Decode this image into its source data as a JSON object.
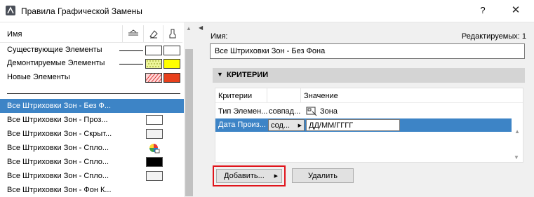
{
  "window": {
    "title": "Правила Графической Замены",
    "help_label": "?",
    "close_label": "✕"
  },
  "left_panel": {
    "column_name": "Имя",
    "standard_rows": [
      {
        "label": "Существующие Элементы",
        "fill1": "#ffffff",
        "fill2": "#ffffff"
      },
      {
        "label": "Демонтируемые Элементы",
        "fill1": "#e8f58a",
        "fill2": "#ffff00"
      },
      {
        "label": "Новые Элементы",
        "fill1": "#ffb3b3",
        "fill2": "#e8401c"
      }
    ],
    "list_rows": [
      {
        "label": "Все Штриховки Зон - Без Ф...",
        "selected": true,
        "swatch": "none"
      },
      {
        "label": "Все Штриховки Зон - Проз...",
        "selected": false,
        "swatch": "white"
      },
      {
        "label": "Все Штриховки Зон - Скрыт...",
        "selected": false,
        "swatch": "light"
      },
      {
        "label": "Все Штриховки Зон - Спло...",
        "selected": false,
        "swatch": "color-wheel"
      },
      {
        "label": "Все Штриховки Зон - Спло...",
        "selected": false,
        "swatch": "black"
      },
      {
        "label": "Все Штриховки Зон - Спло...",
        "selected": false,
        "swatch": "light"
      },
      {
        "label": "Все Штриховки Зон - Фон К...",
        "selected": false,
        "swatch": "none"
      }
    ]
  },
  "right_panel": {
    "name_label": "Имя:",
    "editable_label": "Редактируемых: 1",
    "name_value": "Все Штриховки Зон - Без Фона",
    "criteria_title": "КРИТЕРИИ",
    "table": {
      "headers": [
        "Критерии",
        "Значение"
      ],
      "rows": [
        {
          "criterion": "Тип Элемен...",
          "operator": "совпад...",
          "value": "Зона",
          "selected": false
        },
        {
          "criterion": "Дата Произ...",
          "operator": "сод...",
          "value": "ДД/ММ/ГГГГ",
          "selected": true
        }
      ]
    },
    "add_label": "Добавить...",
    "delete_label": "Удалить"
  },
  "colors": {
    "selection": "#3d84c6",
    "highlight_frame": "#e0141b"
  }
}
